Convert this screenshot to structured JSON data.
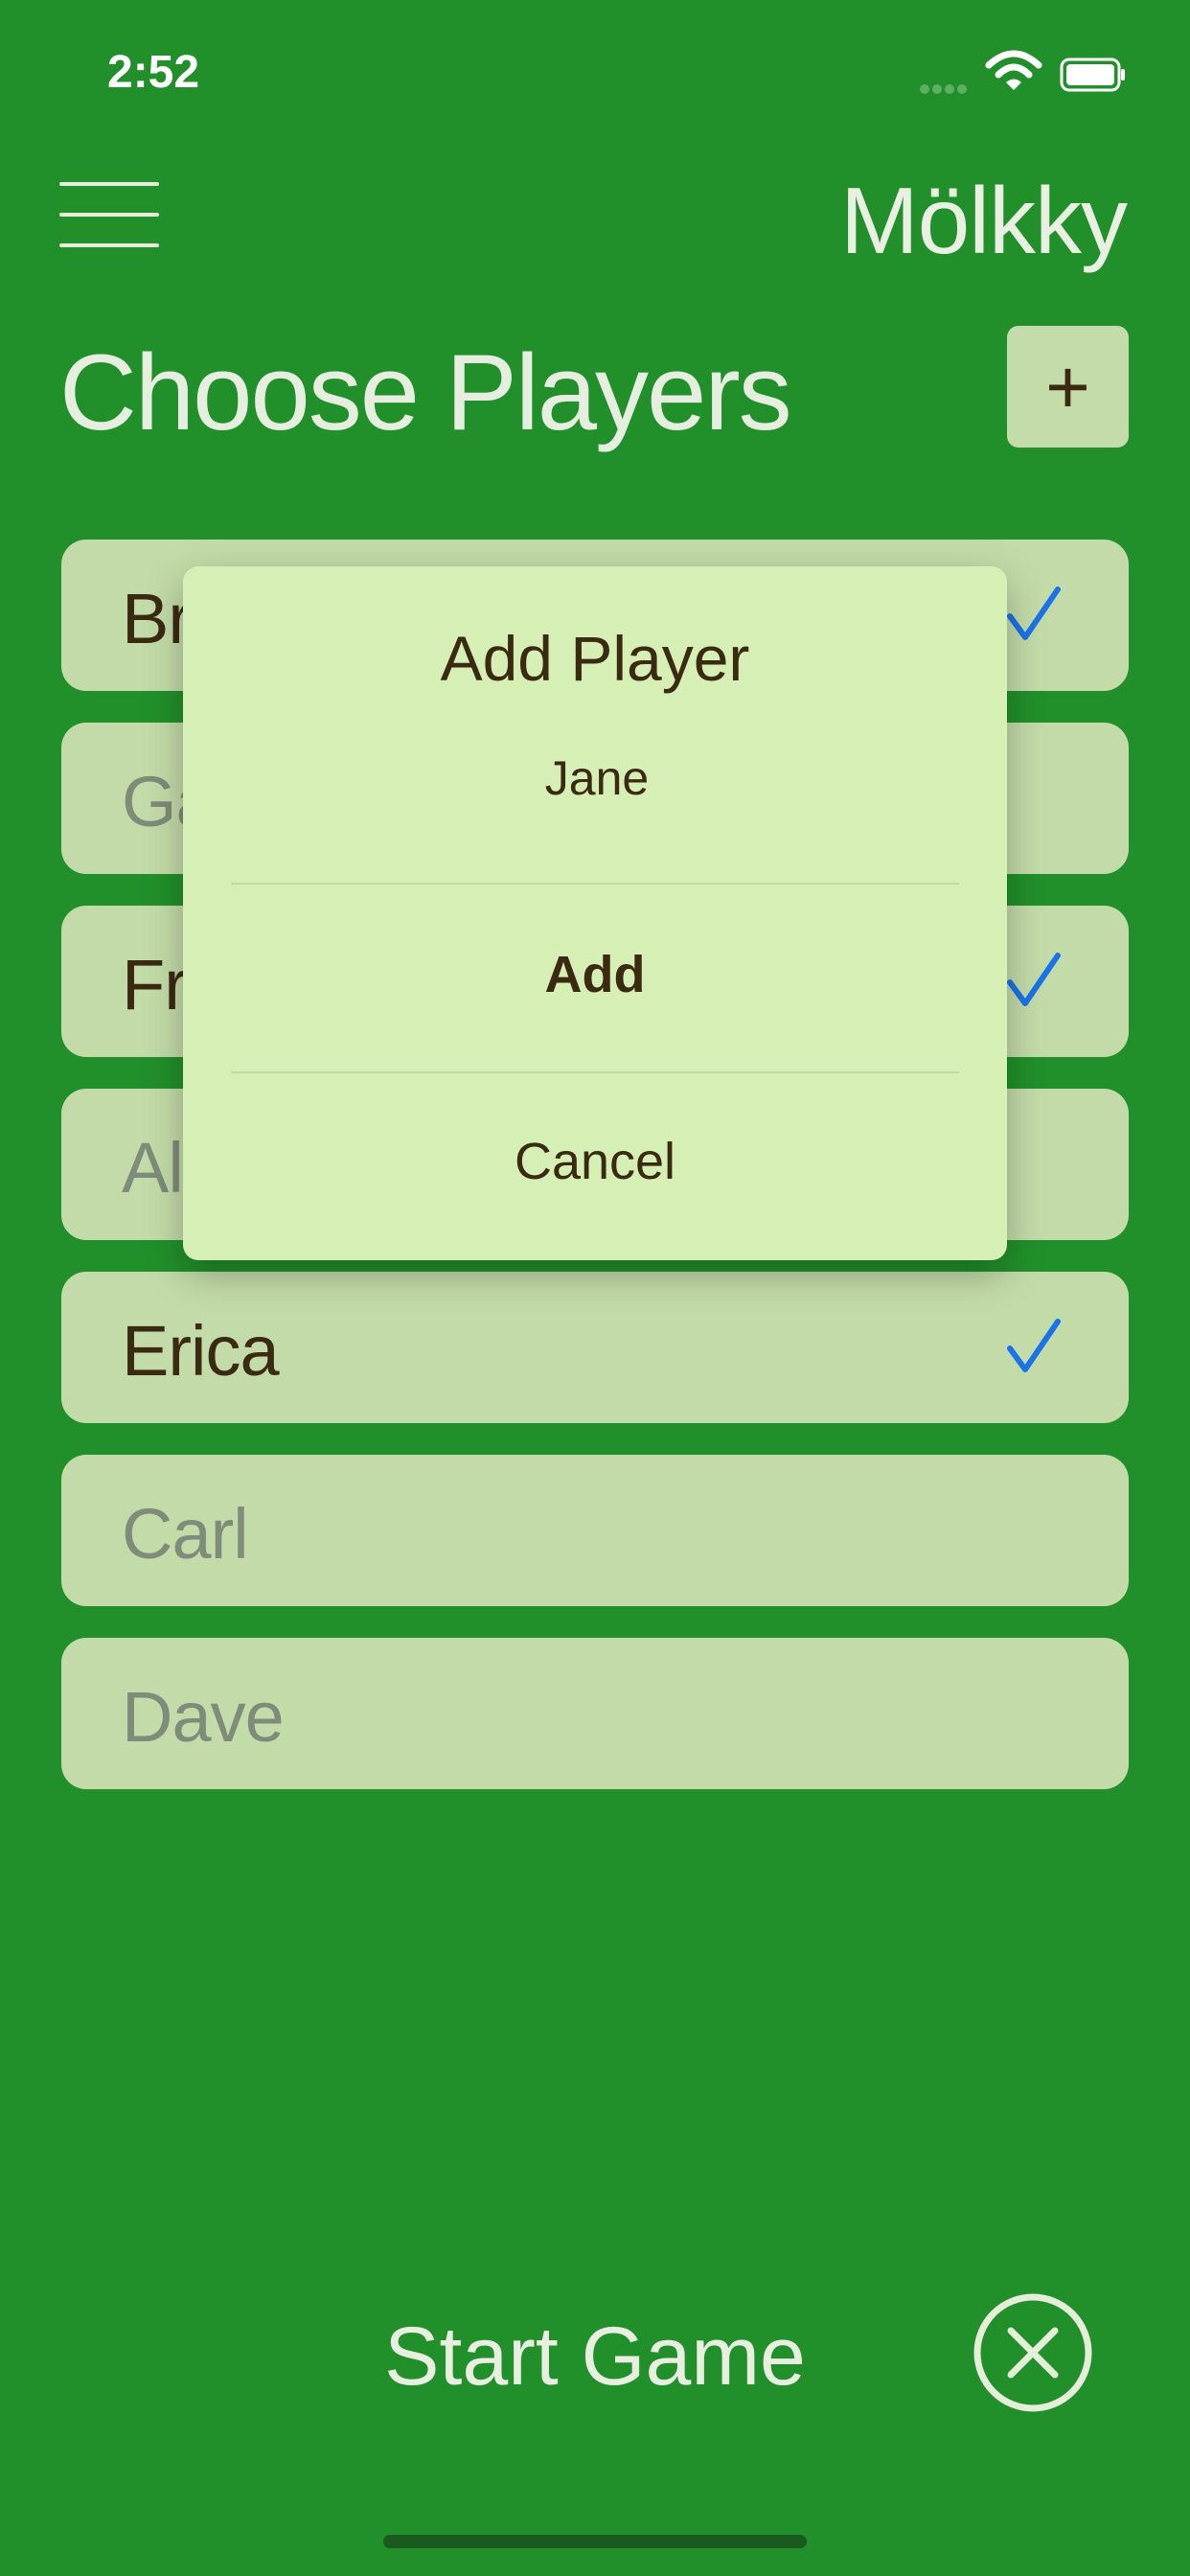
{
  "status": {
    "time": "2:52"
  },
  "header": {
    "app_title": "Mölkky",
    "page_title": "Choose Players",
    "add_label": "+"
  },
  "players": [
    {
      "name": "Br",
      "selected": true
    },
    {
      "name": "Ga",
      "selected": false
    },
    {
      "name": "Fr",
      "selected": true
    },
    {
      "name": "Al",
      "selected": false
    },
    {
      "name": "Erica",
      "selected": true
    },
    {
      "name": "Carl",
      "selected": false
    },
    {
      "name": "Dave",
      "selected": false
    }
  ],
  "dialog": {
    "title": "Add Player",
    "input_value": "Jane",
    "add_label": "Add",
    "cancel_label": "Cancel"
  },
  "footer": {
    "start_label": "Start Game"
  },
  "colors": {
    "background": "#21902b",
    "row": "#c3dba8",
    "dialog": "#d6efb5",
    "check": "#1a73e8"
  }
}
